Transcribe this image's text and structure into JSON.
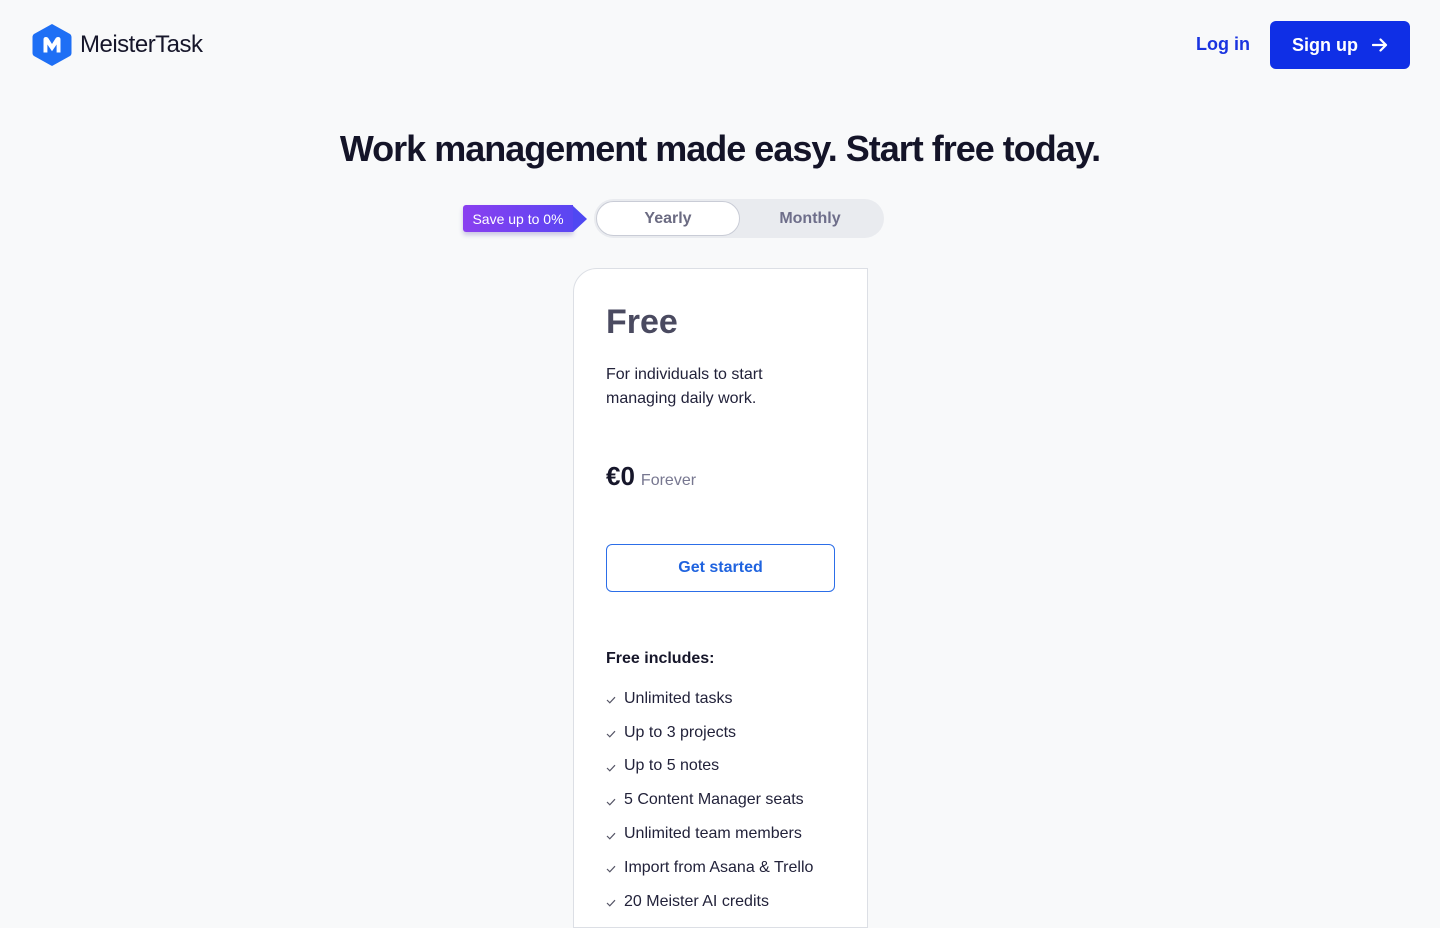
{
  "header": {
    "brand_name": "MeisterTask",
    "brand_color": "#1e6ff5",
    "login_label": "Log in",
    "signup_label": "Sign up",
    "signup_icon": "arrow-right-icon"
  },
  "hero": {
    "headline": "Work management made easy. Start free today."
  },
  "billing": {
    "save_badge": "Save up to 0%",
    "options": [
      "Yearly",
      "Monthly"
    ],
    "selected": "Yearly"
  },
  "plan": {
    "name": "Free",
    "description": "For individuals to start managing daily work.",
    "price": "€0",
    "price_term": "Forever",
    "cta_label": "Get started",
    "includes_title": "Free includes:",
    "features": [
      "Unlimited tasks",
      "Up to 3 projects",
      "Up to 5 notes",
      "5 Content Manager seats",
      "Unlimited team members",
      "Import from Asana & Trello",
      "20 Meister AI credits"
    ]
  },
  "colors": {
    "primary_button": "#0f2fe6",
    "link": "#1a34e0",
    "badge_gradient_start": "#8a3ff0",
    "badge_gradient_end": "#5a46f2",
    "outline_button": "#2c6ee8"
  }
}
